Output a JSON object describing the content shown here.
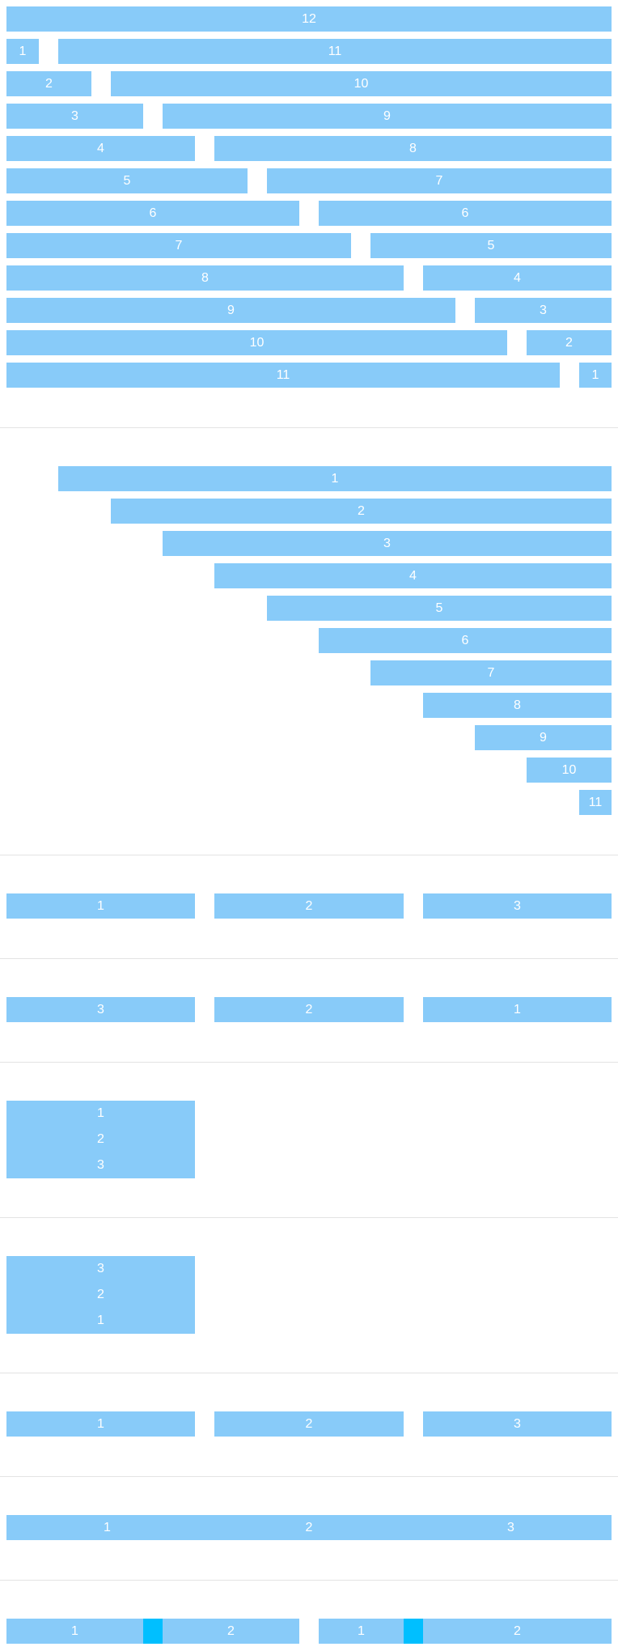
{
  "accent_color": "#00bfff",
  "cell_color": "#88cbf9",
  "row_pairs": [
    {
      "left": "",
      "right": "12"
    },
    {
      "left": "1",
      "right": "11"
    },
    {
      "left": "2",
      "right": "10"
    },
    {
      "left": "3",
      "right": "9"
    },
    {
      "left": "4",
      "right": "8"
    },
    {
      "left": "5",
      "right": "7"
    },
    {
      "left": "6",
      "right": "6"
    },
    {
      "left": "7",
      "right": "5"
    },
    {
      "left": "8",
      "right": "4"
    },
    {
      "left": "9",
      "right": "3"
    },
    {
      "left": "10",
      "right": "2"
    },
    {
      "left": "11",
      "right": "1"
    }
  ],
  "offset_rows": [
    "1",
    "2",
    "3",
    "4",
    "5",
    "6",
    "7",
    "8",
    "9",
    "10",
    "11"
  ],
  "three_col_a": [
    "1",
    "2",
    "3"
  ],
  "three_col_b": [
    "3",
    "2",
    "1"
  ],
  "stack_a": [
    "1",
    "2",
    "3"
  ],
  "stack_b": [
    "3",
    "2",
    "1"
  ],
  "three_col_c": [
    "1",
    "2",
    "3"
  ],
  "wide_row": [
    "1",
    "2",
    "3"
  ],
  "split_left": [
    "1",
    "2"
  ],
  "split_right": [
    "1",
    "2"
  ]
}
